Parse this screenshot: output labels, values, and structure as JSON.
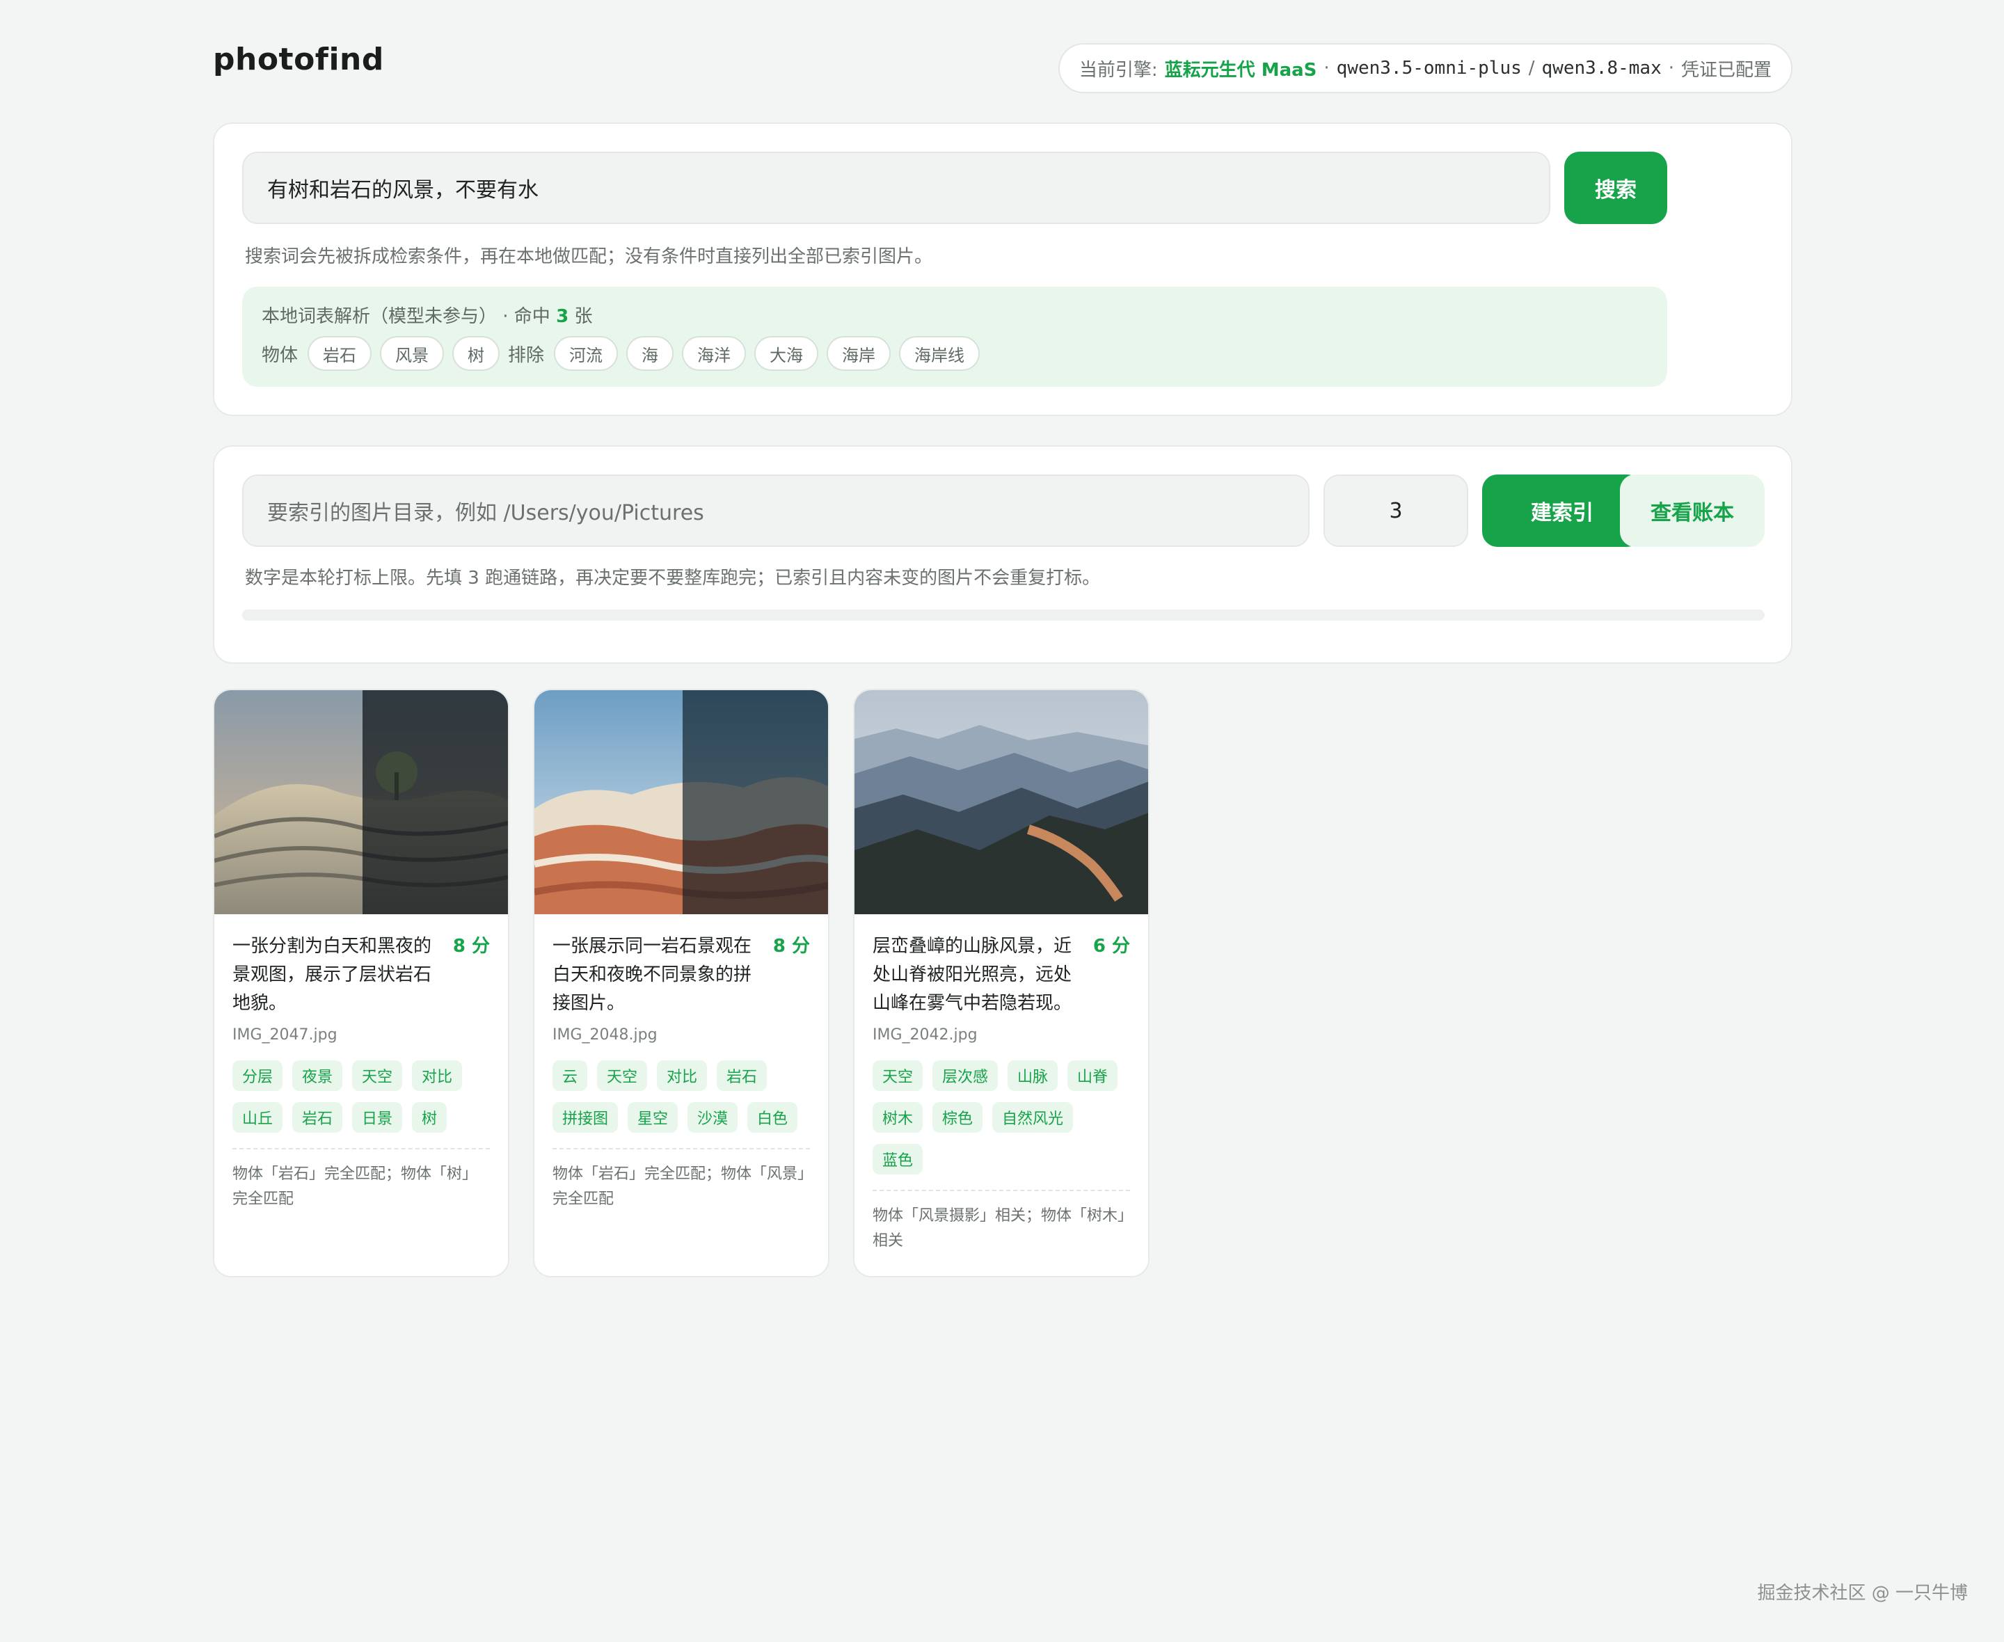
{
  "app": {
    "title": "photofind"
  },
  "engine": {
    "prefix": "当前引擎:",
    "provider": "蓝耘元生代 MaaS",
    "dot1": "·",
    "model1": "qwen3.5-omni-plus",
    "slash": "/",
    "model2": "qwen3.8-max",
    "dot2": "·",
    "credential": "凭证已配置",
    "accent_color": "#16a34a"
  },
  "search": {
    "query": "有树和岩石的风景，不要有水",
    "button_label": "搜索",
    "hint": "搜索词会先被拆成检索条件，再在本地做匹配；没有条件时直接列出全部已索引图片。",
    "parse": {
      "label": "本地词表解析（模型未参与）",
      "hit_prefix": "· 命中",
      "hit_count": "3",
      "hit_suffix": "张",
      "object_label": "物体",
      "objects": [
        "岩石",
        "风景",
        "树"
      ],
      "exclude_label": "排除",
      "excludes": [
        "河流",
        "海",
        "海洋",
        "大海",
        "海岸",
        "海岸线"
      ]
    }
  },
  "index": {
    "dir_placeholder": "要索引的图片目录，例如 /Users/you/Pictures",
    "limit_value": "3",
    "build_button": "建索引",
    "ledger_button": "查看账本",
    "hint": "数字是本轮打标上限。先填 3 跑通链路，再决定要不要整库跑完；已索引且内容未变的图片不会重复打标。",
    "progress": 0
  },
  "results": [
    {
      "description": "一张分割为白天和黑夜的景观图，展示了层状岩石地貌。",
      "score": "8 分",
      "filename": "IMG_2047.jpg",
      "tags": [
        "分层",
        "夜景",
        "天空",
        "对比",
        "山丘",
        "岩石",
        "日景",
        "树"
      ],
      "match": "物体「岩石」完全匹配；物体「树」完全匹配",
      "thumb": "day-night-rock"
    },
    {
      "description": "一张展示同一岩石景观在白天和夜晚不同景象的拼接图片。",
      "score": "8 分",
      "filename": "IMG_2048.jpg",
      "tags": [
        "云",
        "天空",
        "对比",
        "岩石",
        "拼接图",
        "星空",
        "沙漠",
        "白色"
      ],
      "match": "物体「岩石」完全匹配；物体「风景」完全匹配",
      "thumb": "red-rock-split"
    },
    {
      "description": "层峦叠嶂的山脉风景，近处山脊被阳光照亮，远处山峰在雾气中若隐若现。",
      "score": "6 分",
      "filename": "IMG_2042.jpg",
      "tags": [
        "天空",
        "层次感",
        "山脉",
        "山脊",
        "树木",
        "棕色",
        "自然风光",
        "蓝色"
      ],
      "match": "物体「风景摄影」相关；物体「树木」相关",
      "thumb": "misty-mountains"
    }
  ],
  "footer": {
    "watermark": "掘金技术社区 @ 一只牛博"
  }
}
